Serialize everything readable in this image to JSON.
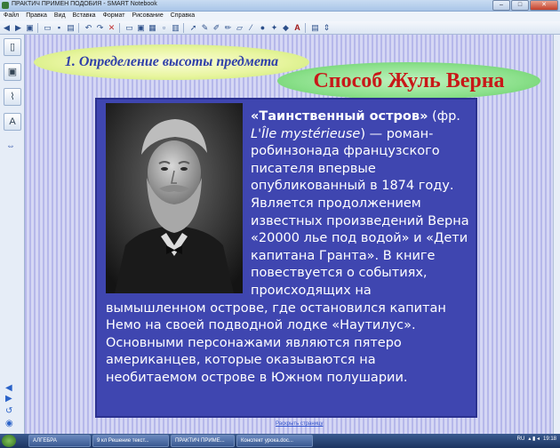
{
  "window": {
    "title": "ПРАКТИЧ ПРИМЕН ПОДОБИЯ - SMART Notebook",
    "controls": [
      "–",
      "□",
      "✕"
    ]
  },
  "menu": [
    "Файл",
    "Правка",
    "Вид",
    "Вставка",
    "Формат",
    "Рисование",
    "Справка"
  ],
  "slide": {
    "subtitle": "1. Определение высоты предмета",
    "method_title": "Способ Жуль Верна",
    "paragraph": {
      "bold_title": "«Таинственный остров»",
      "part1": " (фр. ",
      "italic_title": "L'Île mystérieuse",
      "part2": ") — роман-робинзонада французского писателя впервые опубликованный в 1874 году. Является продолжением известных произведений Верна «20000 лье под водой» и «Дети капитана Гранта». В книге повествуется о событиях, происходящих на вымышленном острове, где остановился капитан Немо на своей подводной лодке «Наутилус». Основными персонажами являются пятеро американцев, которые оказываются на необитаемом острове в Южном полушарии."
    },
    "footer_link": "Раскрыть страницу"
  },
  "taskbar": {
    "items": [
      "АЛГЕБРА",
      "9 кл Решение текст...",
      "ПРАКТИЧ ПРИМЕ...",
      "Конспект урока.doc..."
    ],
    "language": "RU",
    "time": "19:18"
  },
  "colors": {
    "content_bg": "#3f46b0",
    "method_text": "#c81818",
    "subtitle_text": "#3040a8"
  }
}
